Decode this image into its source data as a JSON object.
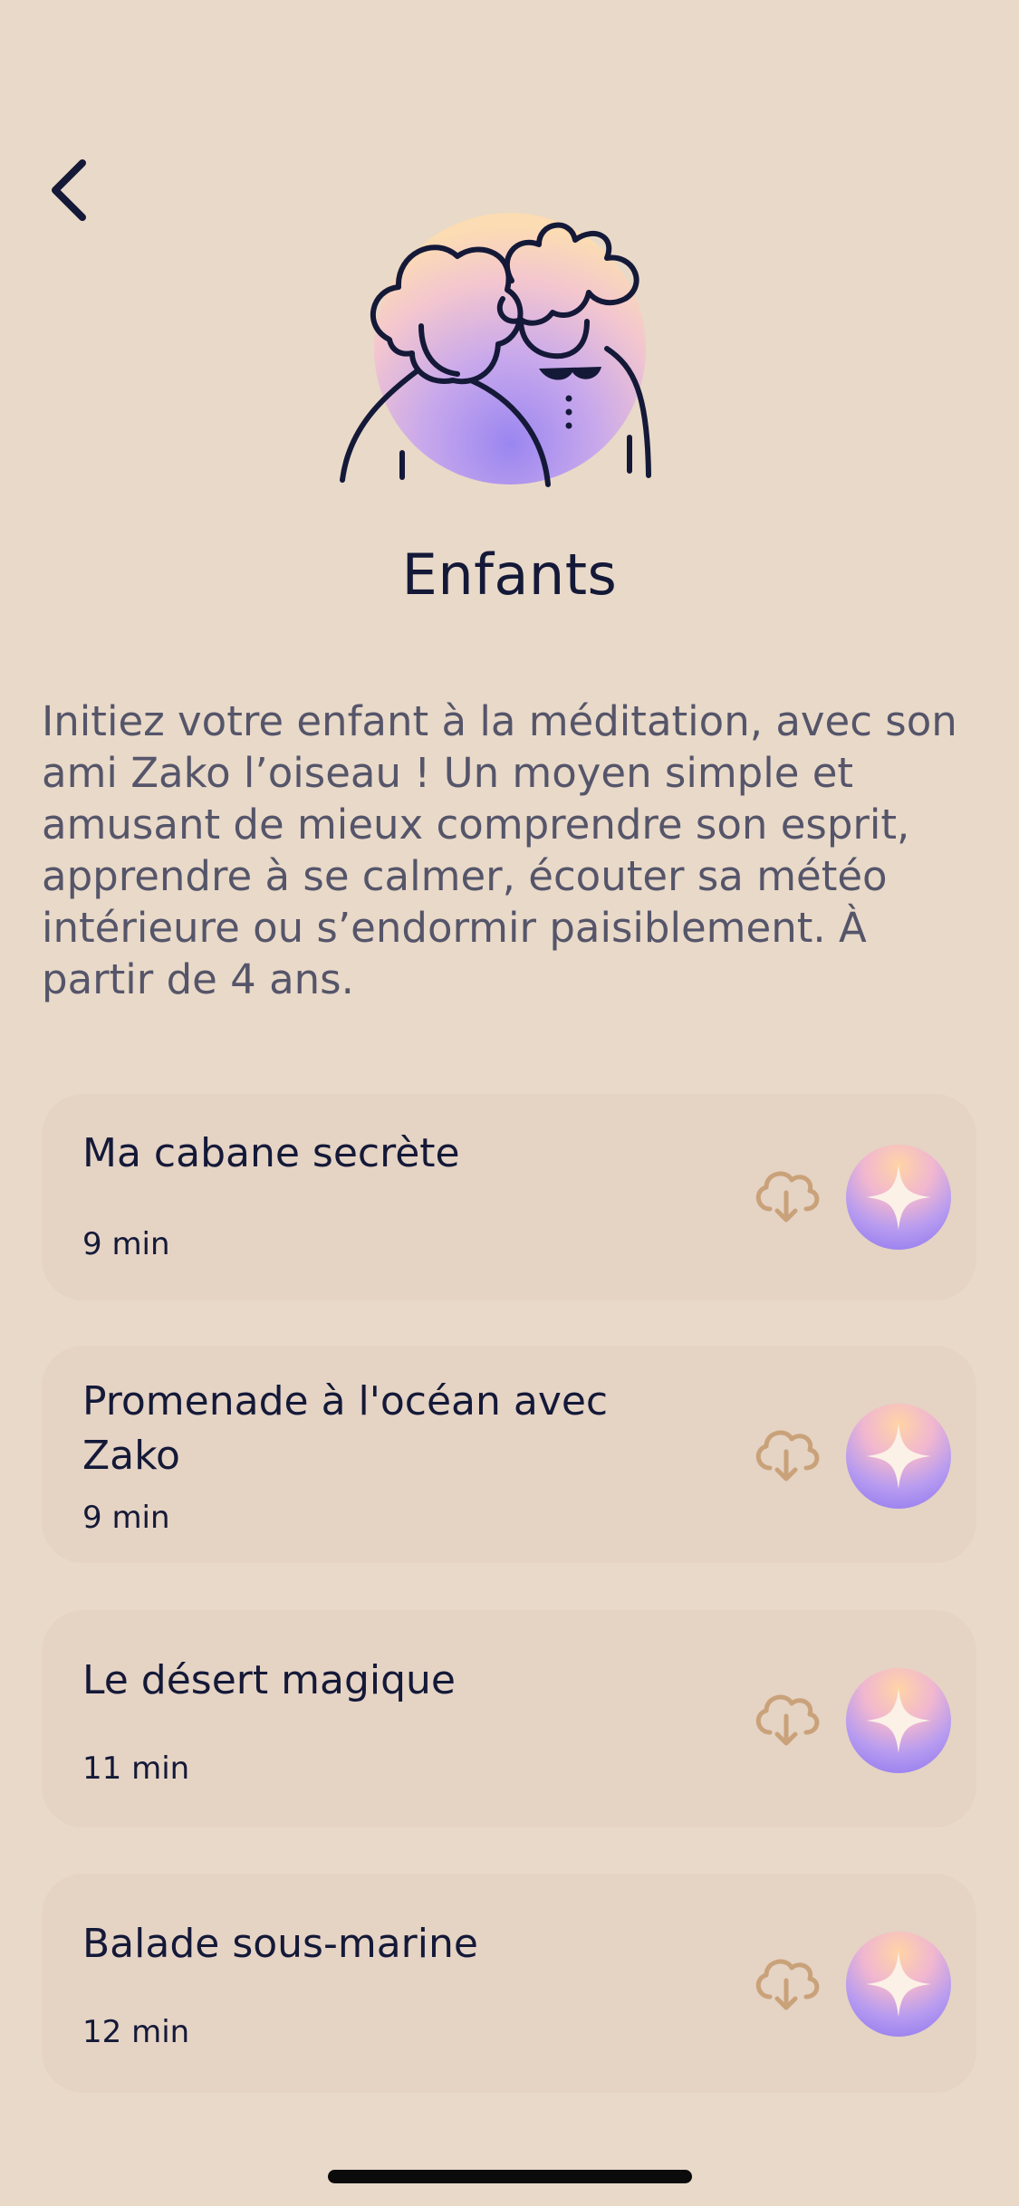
{
  "header": {
    "title": "Enfants",
    "back_icon": "chevron-left-icon"
  },
  "hero": {
    "icon": "children-illustration"
  },
  "description": "Initiez votre enfant à la méditation, avec son ami Zako l’oiseau ! Un moyen simple et amusant de mieux comprendre son esprit, apprendre à se calmer, écouter sa météo intérieure ou s’endormir paisiblement. À partir de 4 ans.",
  "sessions": [
    {
      "title": "Ma cabane secrète",
      "duration": "9 min"
    },
    {
      "title": "Promenade à l'océan avec Zako",
      "duration": "9 min"
    },
    {
      "title": "Le désert magique",
      "duration": "11 min"
    },
    {
      "title": "Balade sous-marine",
      "duration": "12 min"
    }
  ],
  "colors": {
    "background": "#e9d9c8",
    "card": "#e5d3c4",
    "text": "#141938",
    "download_icon": "#c9a27a",
    "play_gradient": [
      "#ffd4a6",
      "#f1b7cf",
      "#b79bf0",
      "#8a73ee"
    ]
  }
}
